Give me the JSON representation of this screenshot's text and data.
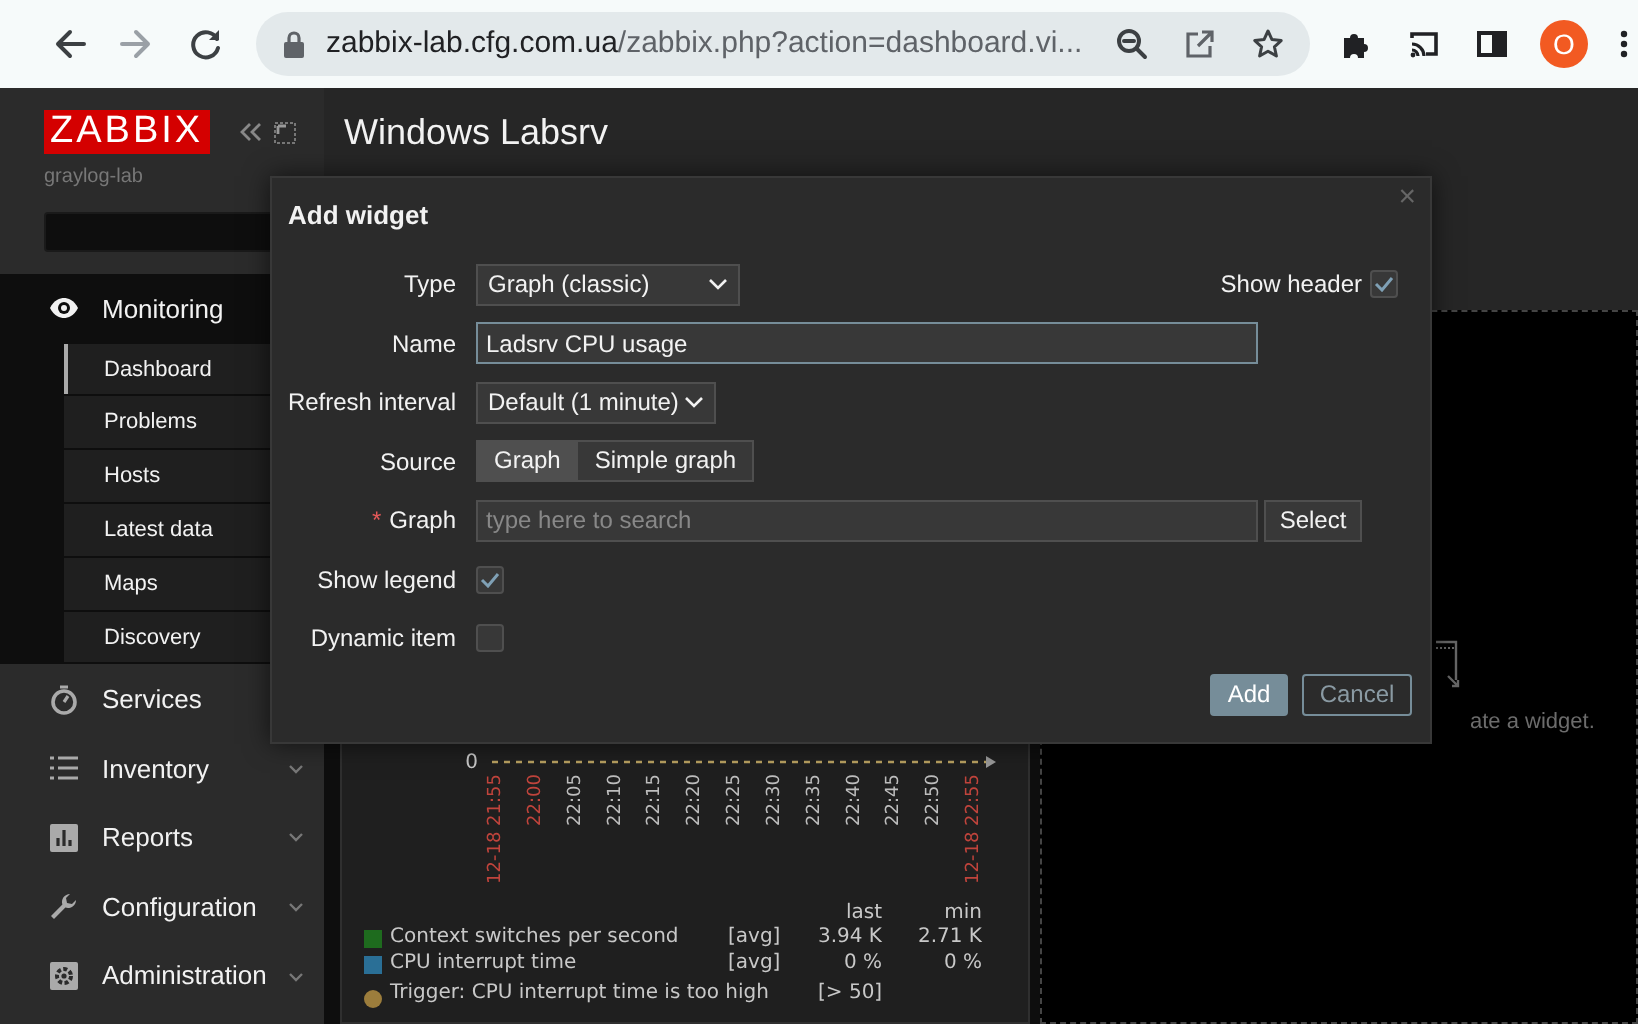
{
  "browser": {
    "url_host": "zabbix-lab.cfg.com.ua",
    "url_path": "/zabbix.php?action=dashboard.vi...",
    "profile_initial": "O"
  },
  "sidebar": {
    "logo": "ZABBIX",
    "server_name": "graylog-lab",
    "menu": [
      {
        "label": "Monitoring",
        "kind": "eye",
        "expanded": true,
        "children": [
          {
            "label": "Dashboard",
            "selected": true
          },
          {
            "label": "Problems",
            "selected": false
          },
          {
            "label": "Hosts",
            "selected": false
          },
          {
            "label": "Latest data",
            "selected": false
          },
          {
            "label": "Maps",
            "selected": false
          },
          {
            "label": "Discovery",
            "selected": false
          }
        ]
      },
      {
        "label": "Services",
        "kind": "stopwatch",
        "expanded": false
      },
      {
        "label": "Inventory",
        "kind": "list",
        "submenu": true,
        "expanded": false
      },
      {
        "label": "Reports",
        "kind": "chart",
        "submenu": true,
        "expanded": false
      },
      {
        "label": "Configuration",
        "kind": "wrench",
        "submenu": true,
        "expanded": false
      },
      {
        "label": "Administration",
        "kind": "gear",
        "submenu": true,
        "expanded": false
      }
    ]
  },
  "dashboard": {
    "title": "Windows Labsrv",
    "graph_widget": {
      "y_tick": "0",
      "x_ticks": [
        {
          "label": "12-18 21:55",
          "highlight": true
        },
        {
          "label": "22:00",
          "highlight": true
        },
        {
          "label": "22:05",
          "highlight": false
        },
        {
          "label": "22:10",
          "highlight": false
        },
        {
          "label": "22:15",
          "highlight": false
        },
        {
          "label": "22:20",
          "highlight": false
        },
        {
          "label": "22:25",
          "highlight": false
        },
        {
          "label": "22:30",
          "highlight": false
        },
        {
          "label": "22:35",
          "highlight": false
        },
        {
          "label": "22:40",
          "highlight": false
        },
        {
          "label": "22:45",
          "highlight": false
        },
        {
          "label": "22:50",
          "highlight": false
        },
        {
          "label": "12-18 22:55",
          "highlight": true
        }
      ],
      "legend_columns": [
        "last",
        "min"
      ],
      "legend": [
        {
          "name": "Context switches per second",
          "color": "#1e6b1e",
          "function": "[avg]",
          "last": "3.94 K",
          "min": "2.71 K"
        },
        {
          "name": "CPU interrupt time",
          "color": "#2a6f96",
          "function": "[avg]",
          "last": "0 %",
          "min": "0 %"
        }
      ],
      "trigger": {
        "text": "Trigger: CPU interrupt time is too high",
        "color": "#9c7d3c",
        "value": "[> 50]"
      }
    },
    "empty_widget_hint": "ate a widget."
  },
  "dialog": {
    "title": "Add widget",
    "close": "×",
    "type": {
      "label": "Type",
      "value": "Graph (classic)"
    },
    "show_header": {
      "label": "Show header",
      "checked": true
    },
    "name": {
      "label": "Name",
      "value": "Ladsrv CPU usage",
      "focused": true
    },
    "refresh": {
      "label": "Refresh interval",
      "value": "Default (1 minute)"
    },
    "source": {
      "label": "Source",
      "options": [
        {
          "label": "Graph",
          "selected": true
        },
        {
          "label": "Simple graph",
          "selected": false
        }
      ]
    },
    "graph": {
      "label": "Graph",
      "required_mark": "*",
      "placeholder": "type here to search",
      "button": "Select"
    },
    "show_legend": {
      "label": "Show legend",
      "checked": true
    },
    "dynamic_item": {
      "label": "Dynamic item",
      "checked": false
    },
    "buttons": [
      {
        "label": "Add",
        "primary": true
      },
      {
        "label": "Cancel",
        "primary": false
      }
    ]
  }
}
